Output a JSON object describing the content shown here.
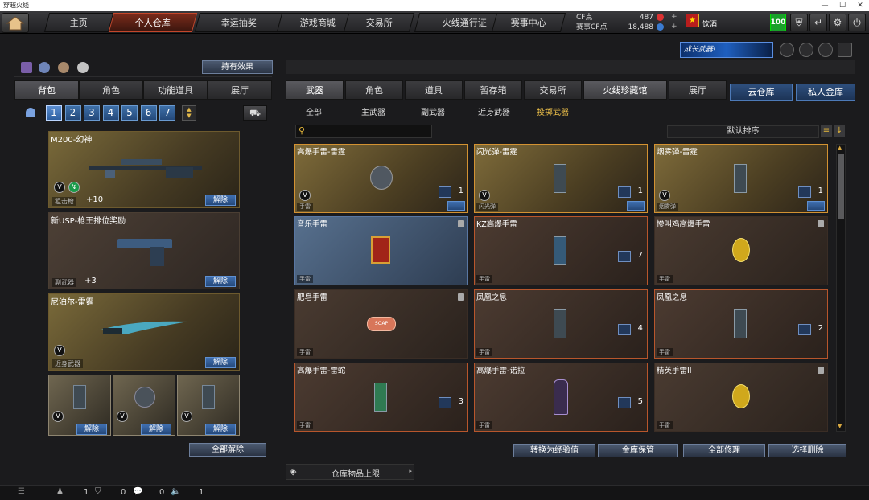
{
  "window": {
    "title": "穿越火线"
  },
  "nav": {
    "tabs": [
      "主页",
      "个人仓库",
      "幸运抽奖",
      "游戏商城",
      "交易所",
      "火线通行证",
      "赛事中心"
    ],
    "active": 1
  },
  "currency": {
    "cf_label": "CF点",
    "cf_value": "487",
    "match_label": "赛事CF点",
    "match_value": "18,488"
  },
  "user": {
    "name": "饮酒",
    "level": "100"
  },
  "banner": {
    "text": "成长武器!"
  },
  "left": {
    "effects_button": "持有效果",
    "tabs": [
      "背包",
      "角色",
      "功能道具",
      "展厅"
    ],
    "pages": [
      "1",
      "2",
      "3",
      "4",
      "5",
      "6",
      "7"
    ],
    "cards": [
      {
        "name": "M200-幻神",
        "tag": "狙击枪",
        "extra": "+10",
        "button": "解除"
      },
      {
        "name": "新USP-枪王排位奖励",
        "tag": "副武器",
        "extra": "+3",
        "button": "解除"
      },
      {
        "name": "尼泊尔-雷霆",
        "tag": "近身武器",
        "extra": "",
        "button": "解除"
      }
    ],
    "small_buttons": [
      "解除",
      "解除",
      "解除"
    ],
    "release_all": "全部解除"
  },
  "right": {
    "tabs": [
      "武器",
      "角色",
      "道具",
      "暂存箱",
      "交易所",
      "火线珍藏馆",
      "展厅"
    ],
    "cloud_tabs": [
      "云仓库",
      "私人金库"
    ],
    "subtabs": [
      "全部",
      "主武器",
      "副武器",
      "近身武器",
      "投掷武器"
    ],
    "sort": "默认排序",
    "search_placeholder": "",
    "items": [
      {
        "name": "高爆手雷-雷霆",
        "tag": "手雷",
        "count": "1"
      },
      {
        "name": "闪光弹-雷霆",
        "tag": "闪光弹",
        "count": "1"
      },
      {
        "name": "烟雾弹-雷霆",
        "tag": "烟雾弹",
        "count": "1"
      },
      {
        "name": "音乐手雷",
        "tag": "手雷",
        "count": ""
      },
      {
        "name": "KZ高爆手雷",
        "tag": "手雷",
        "count": "7"
      },
      {
        "name": "惨叫鸡高爆手雷",
        "tag": "手雷",
        "count": ""
      },
      {
        "name": "肥皂手雷",
        "tag": "手雷",
        "count": ""
      },
      {
        "name": "凤凰之息",
        "tag": "手雷",
        "count": "4"
      },
      {
        "name": "凤凰之息",
        "tag": "手雷",
        "count": "2"
      },
      {
        "name": "高爆手雷-雷蛇",
        "tag": "手雷",
        "count": "3"
      },
      {
        "name": "高爆手雷-诺拉",
        "tag": "手雷",
        "count": "5"
      },
      {
        "name": "精英手雷II",
        "tag": "手雷",
        "count": ""
      }
    ],
    "soap_label": "SOAP",
    "actions": [
      "转换为经验值",
      "金库保管",
      "全部修理",
      "选择删除"
    ],
    "capacity_label": "仓库物品上限"
  },
  "status": {
    "v1": "1",
    "v2": "0",
    "v3": "0",
    "v4": "1"
  }
}
